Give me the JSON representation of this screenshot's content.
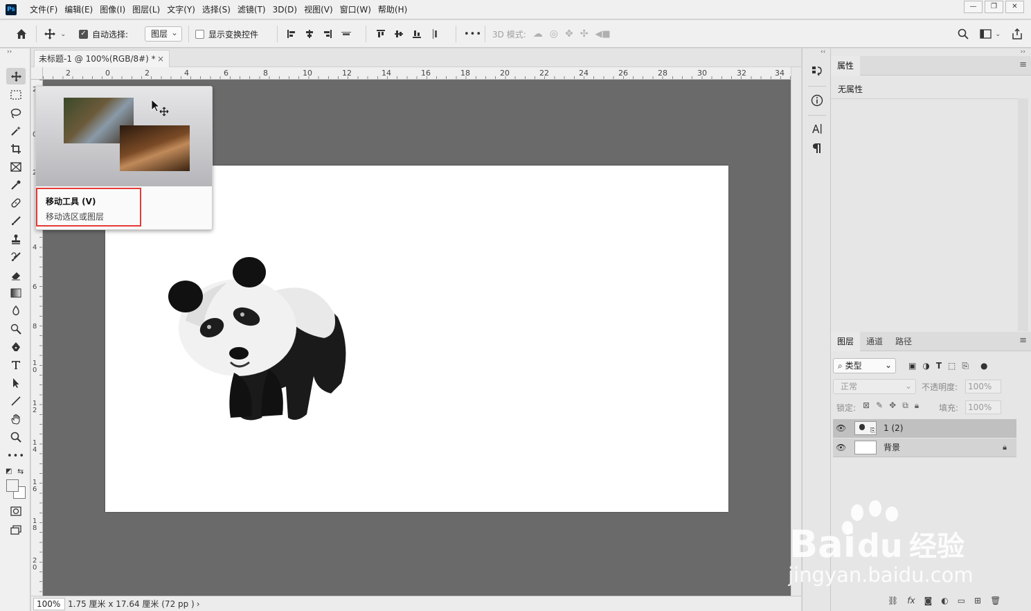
{
  "app": {
    "logo": "Ps"
  },
  "menu": [
    "文件(F)",
    "编辑(E)",
    "图像(I)",
    "图层(L)",
    "文字(Y)",
    "选择(S)",
    "滤镜(T)",
    "3D(D)",
    "视图(V)",
    "窗口(W)",
    "帮助(H)"
  ],
  "window_controls": {
    "minimize": "—",
    "restore": "❐",
    "close": "✕"
  },
  "options": {
    "auto_select_label": "自动选择:",
    "auto_select_checked": true,
    "auto_select_target": "图层",
    "show_transform_label": "显示变换控件",
    "show_transform_checked": false,
    "more": "•••",
    "mode_3d_label": "3D 模式:"
  },
  "document": {
    "tab_title": "未标题-1 @ 100%(RGB/8#) *",
    "close": "×",
    "zoom": "100%",
    "info": "1.75 厘米 x 17.64 厘米 (72 pp )",
    "info_arrow": "›"
  },
  "ruler": {
    "h_labels": [
      "2",
      "0",
      "2",
      "4",
      "6",
      "8",
      "10",
      "12",
      "14",
      "16",
      "18",
      "20",
      "22",
      "24",
      "26",
      "28",
      "30",
      "32",
      "34"
    ],
    "v_labels": [
      "2",
      "0",
      "2",
      "4",
      "6",
      "8",
      "10",
      "12",
      "14",
      "16",
      "18",
      "20"
    ]
  },
  "tooltip": {
    "title": "移动工具 (V)",
    "description": "移动选区或图层"
  },
  "properties_panel": {
    "tab": "属性",
    "empty_text": "无属性"
  },
  "layers_panel": {
    "tabs": [
      "图层",
      "通道",
      "路径"
    ],
    "filter_label": "类型",
    "blend_mode": "正常",
    "opacity_label": "不透明度:",
    "opacity_value": "100%",
    "lock_label": "锁定:",
    "fill_label": "填充:",
    "fill_value": "100%",
    "layers": [
      {
        "name": "1 (2)",
        "selected": true,
        "locked": false
      },
      {
        "name": "背景",
        "selected": false,
        "locked": true
      }
    ]
  },
  "watermark": {
    "brand_a": "Bai",
    "brand_b": "du",
    "brand_c": "经验",
    "url": "jingyan.baidu.com"
  },
  "colors": {
    "workspace": "#6a6a6a",
    "chrome": "#f0f0f0",
    "highlight": "#e53935"
  }
}
